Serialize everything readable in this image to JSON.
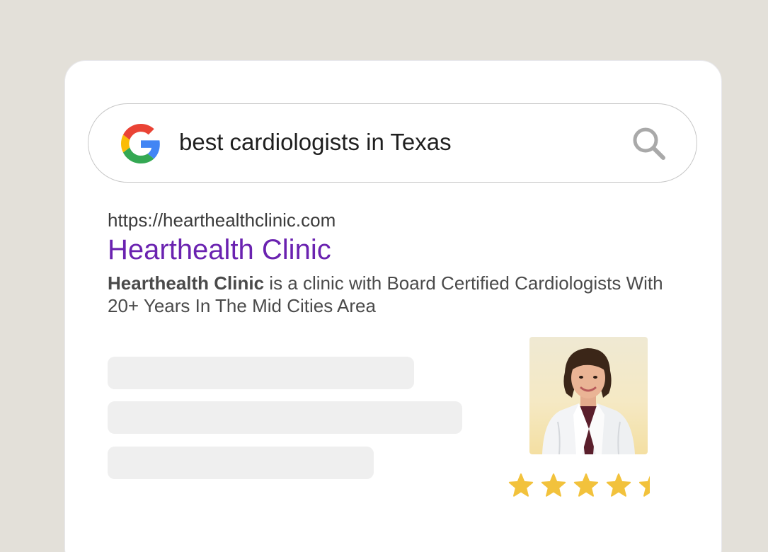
{
  "search": {
    "query": "best cardiologists in Texas"
  },
  "result": {
    "url": "https://hearthealthclinic.com",
    "title": "Hearthealth Clinic",
    "description_bold": "Hearthealth Clinic",
    "description_rest": " is a clinic with Board Certified Cardiologists With 20+ Years In The Mid Cities Area"
  },
  "rating": {
    "stars": 4.5,
    "max": 5,
    "star_color": "#f2c23c"
  },
  "colors": {
    "background": "#e3e0d9",
    "card": "#ffffff",
    "title_link": "#6a22b0",
    "skeleton": "#efefef"
  },
  "icons": {
    "logo": "google-g-icon",
    "search": "magnifier-icon",
    "star": "star-icon"
  }
}
